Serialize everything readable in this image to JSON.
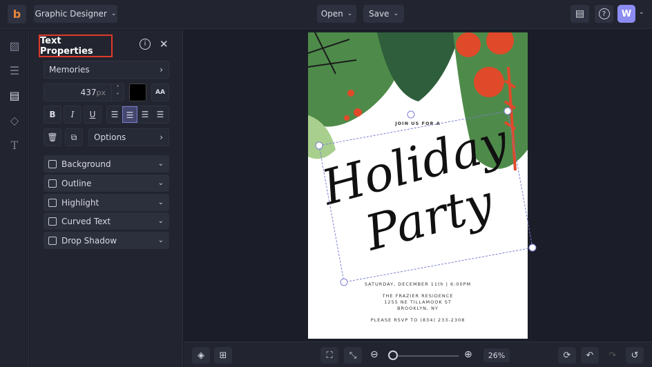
{
  "topbar": {
    "app_menu": "Graphic Designer",
    "open": "Open",
    "save": "Save",
    "avatar": "W"
  },
  "panel": {
    "title": "Text Properties",
    "font": "Memories",
    "size": "437",
    "unit": "px",
    "options": "Options",
    "bold": "B",
    "italic": "I",
    "underline": "U",
    "sections": [
      "Background",
      "Outline",
      "Highlight",
      "Curved Text",
      "Drop Shadow"
    ],
    "color": "#000000"
  },
  "card": {
    "header": "JOIN US FOR A",
    "title_line1": "Holiday",
    "title_line2": "Party",
    "date": "SATURDAY, DECEMBER 11th | 6:00PM",
    "venue": "THE FRAZIER RESIDENCE",
    "address": "1255 NE TILLAMOOK ST",
    "city": "BROOKLYN, NY",
    "rsvp": "PLEASE RSVP TO (834) 233-2308"
  },
  "zoom": {
    "level": "26%",
    "fraction": 0.05
  }
}
